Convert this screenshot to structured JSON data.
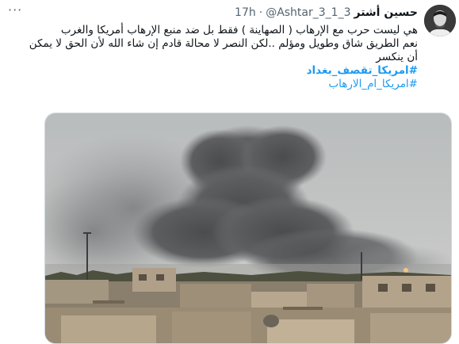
{
  "tweet": {
    "author_name": "حسين أشتر",
    "handle": "@Ashtar_3_1_3",
    "separator": "·",
    "time": "17h",
    "more_label": "···",
    "line1": "هي ليست حرب مع الإرهاب ( الصهاينة )  فقط بل ضد منبع الإرهاب أمريكا والغرب",
    "line2": "نعم الطريق شاق وطويل ومؤلم ..لكن النصر لا محالة قادم إن شاء الله لأن الحق لا يمكن",
    "line3": "أن ينكسر",
    "hashtag1": "#امريكا_تقصف_بغداد",
    "hashtag2": "#امريكا_ام_الارهاب"
  },
  "colors": {
    "link": "#1d9bf0",
    "secondary": "#536471"
  },
  "icons": {
    "more": "more-dots-icon"
  }
}
